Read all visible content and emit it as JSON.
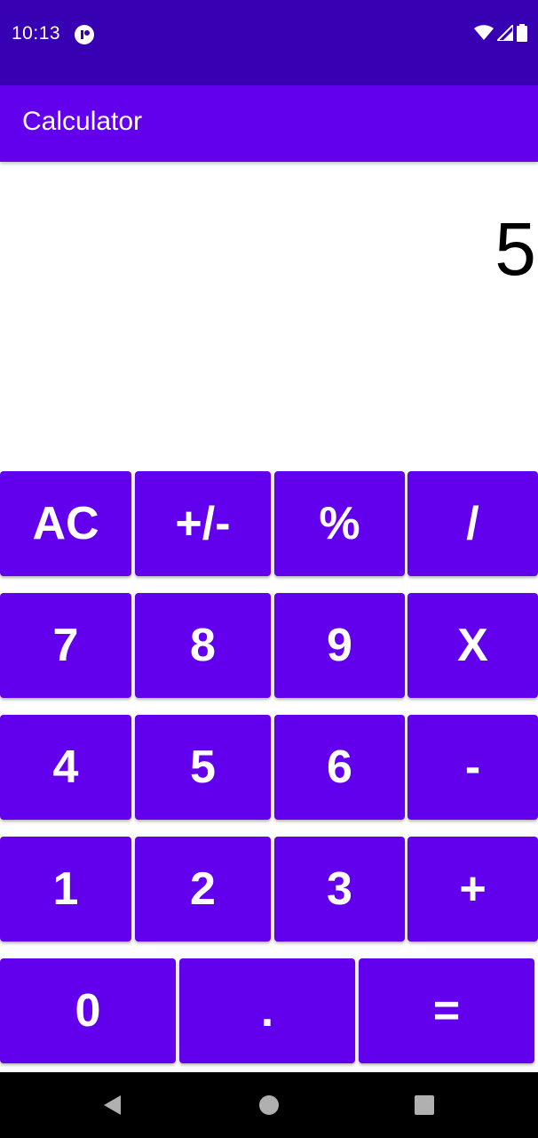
{
  "status_bar": {
    "time": "10:13",
    "icons": [
      "app-notification-icon",
      "wifi-icon",
      "signal-icon",
      "battery-icon"
    ]
  },
  "app_bar": {
    "title": "Calculator"
  },
  "display": {
    "value": "5"
  },
  "keypad": {
    "row1": [
      "AC",
      "+/-",
      "%",
      "/"
    ],
    "row2": [
      "7",
      "8",
      "9",
      "X"
    ],
    "row3": [
      "4",
      "5",
      "6",
      "-"
    ],
    "row4": [
      "1",
      "2",
      "3",
      "+"
    ],
    "row5": [
      "0",
      ".",
      "="
    ]
  },
  "nav_bar": {
    "icons": [
      "back-icon",
      "home-icon",
      "recents-icon"
    ]
  },
  "colors": {
    "status_bar": "#3700b3",
    "primary": "#6200ee",
    "key_text": "#ffffff",
    "nav_bar": "#000000"
  }
}
